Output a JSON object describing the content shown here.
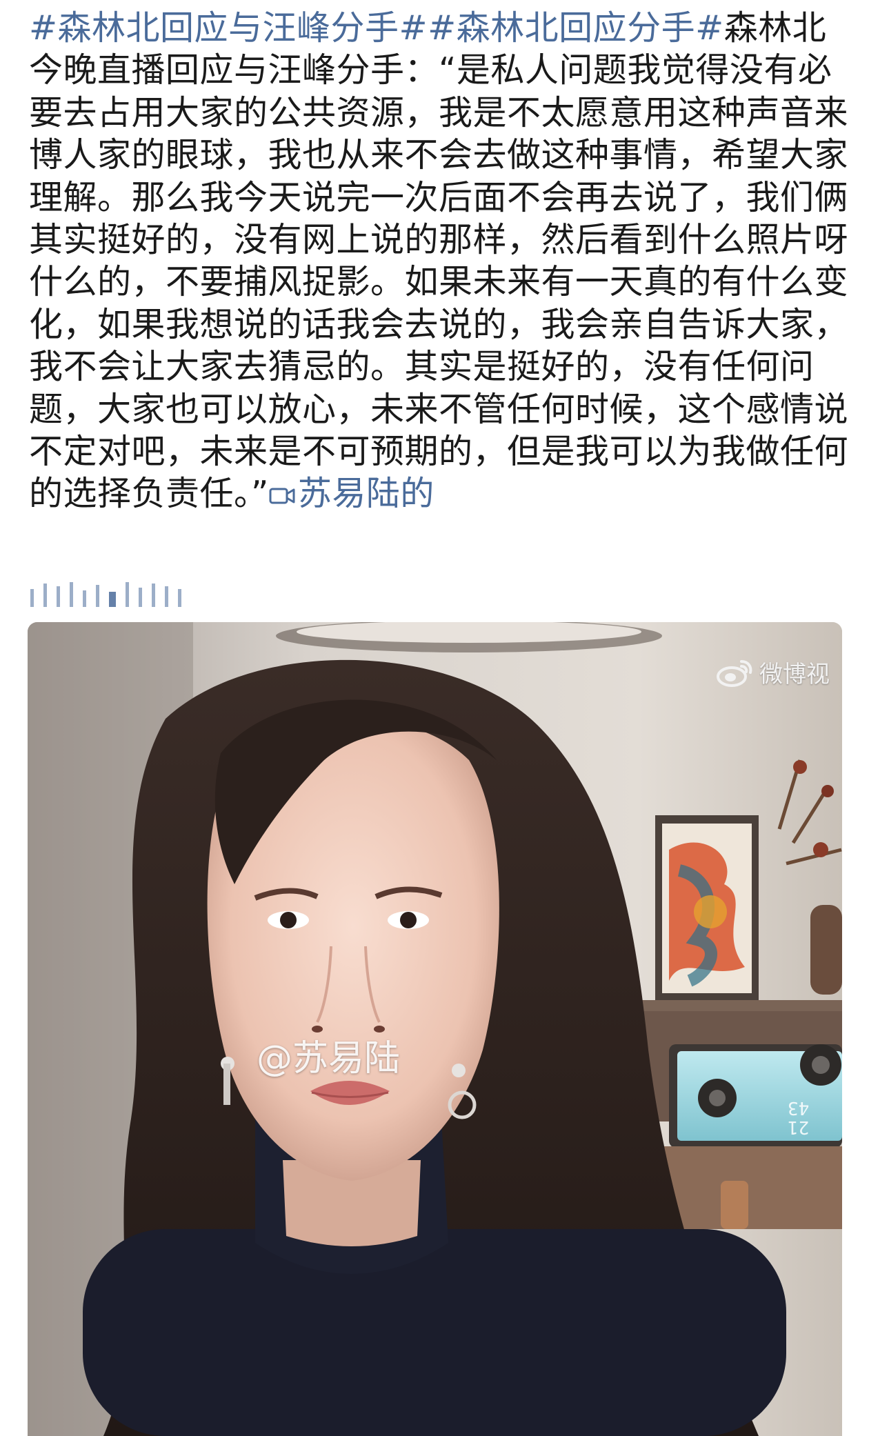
{
  "post": {
    "hashtag_1": "#森林北回应与汪峰分手#",
    "hashtag_2": "#森林北回应分手#",
    "body": "森林北今晚直播回应与汪峰分手：“是私人问题我觉得没有必要去占用大家的公共资源，我是不太愿意用这种声音来博人家的眼球，我也从来不会去做这种事情，希望大家理解。那么我今天说完一次后面不会再去说了，我们俩其实挺好的，没有网上说的那样，然后看到什么照片呀什么的，不要捕风捉影。如果未来有一天真的有什么变化，如果我想说的话我会去说的，我会亲自告诉大家，我不会让大家去猜忌的。其实是挺好的，没有任何问题，大家也可以放心，未来不管任何时候，这个感情说不定对吧，未来是不可预期的，但是我可以为我做任何的选择负责任。”",
    "video_link_label": "苏易陆的"
  },
  "video": {
    "watermark": "微博视",
    "overlay_tag": "@苏易陆",
    "clock_hour": "21",
    "clock_minute": "43"
  },
  "colors": {
    "link": "#4a6b9a",
    "text": "#1a1a1a"
  },
  "icons": [
    "video-camera-icon",
    "weibo-logo-icon",
    "waveform-icon"
  ]
}
